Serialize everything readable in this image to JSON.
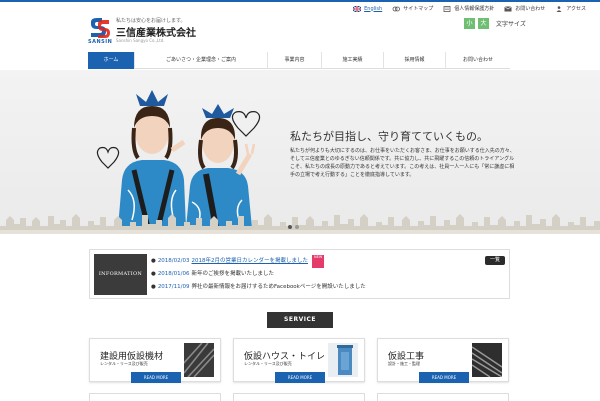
{
  "header": {
    "tagline": "私たちは安心をお届けします。",
    "company_name": "三信産業株式会社",
    "company_en": "Sanshin Sangyo Co.,Ltd.",
    "logo_text": "SANSIN"
  },
  "toplinks": {
    "english": "English",
    "sitemap": "サイトマップ",
    "privacy": "個人情報保護方針",
    "contact": "お問い合わせ",
    "access": "アクセス"
  },
  "fontsize": {
    "small": "小",
    "large": "大",
    "label": "文字サイズ"
  },
  "nav": {
    "items": [
      {
        "label": "ホーム"
      },
      {
        "label": "ごあいさつ・企業理念・ご案内"
      },
      {
        "label": "事業内容"
      },
      {
        "label": "施工実績"
      },
      {
        "label": "採用情報"
      },
      {
        "label": "お問い合わせ"
      }
    ]
  },
  "hero": {
    "title": "私たちが目指し、守り育てていくもの。",
    "body": "私たちが何よりも大切にするのは、お仕事をいただくお客さま、お仕事をお願いする仕入先の方々、そして三信産業とのゆるぎない信頼関係です。共に協力し、共に飛躍するこの信頼のトライアングルこそ、私たちの成長の原動力であると考えています。この考えは、社員一人一人にも「常に謙虚に相手の立場で考え行動する」ことを徹底指導しています。"
  },
  "info": {
    "label": "INFORMATION",
    "more": "一覧",
    "news": [
      {
        "date": "2018/02/03",
        "title": "2018年2月の営業日カレンダーを掲載しました",
        "link": true,
        "new_badge": "NEW"
      },
      {
        "date": "2018/01/06",
        "title": "新年のご挨拶を掲載いたしました",
        "link": false
      },
      {
        "date": "2017/11/09",
        "title": "弊社の最新情報をお届けするためFacebookページを開設いたしました",
        "link": false
      }
    ]
  },
  "service": {
    "heading": "SERVICE",
    "cards": [
      {
        "title": "建設用仮設機材",
        "sub": "レンタル・リース及び販売",
        "button": "READ MORE"
      },
      {
        "title": "仮設ハウス・トイレ",
        "sub": "レンタル・リース及び販売",
        "button": "READ MORE"
      },
      {
        "title": "仮設工事",
        "sub": "設計・施工・監理",
        "button": "READ MORE"
      }
    ]
  },
  "colors": {
    "brand_blue": "#1b62b0",
    "dark": "#333333",
    "green": "#6fbf73"
  }
}
